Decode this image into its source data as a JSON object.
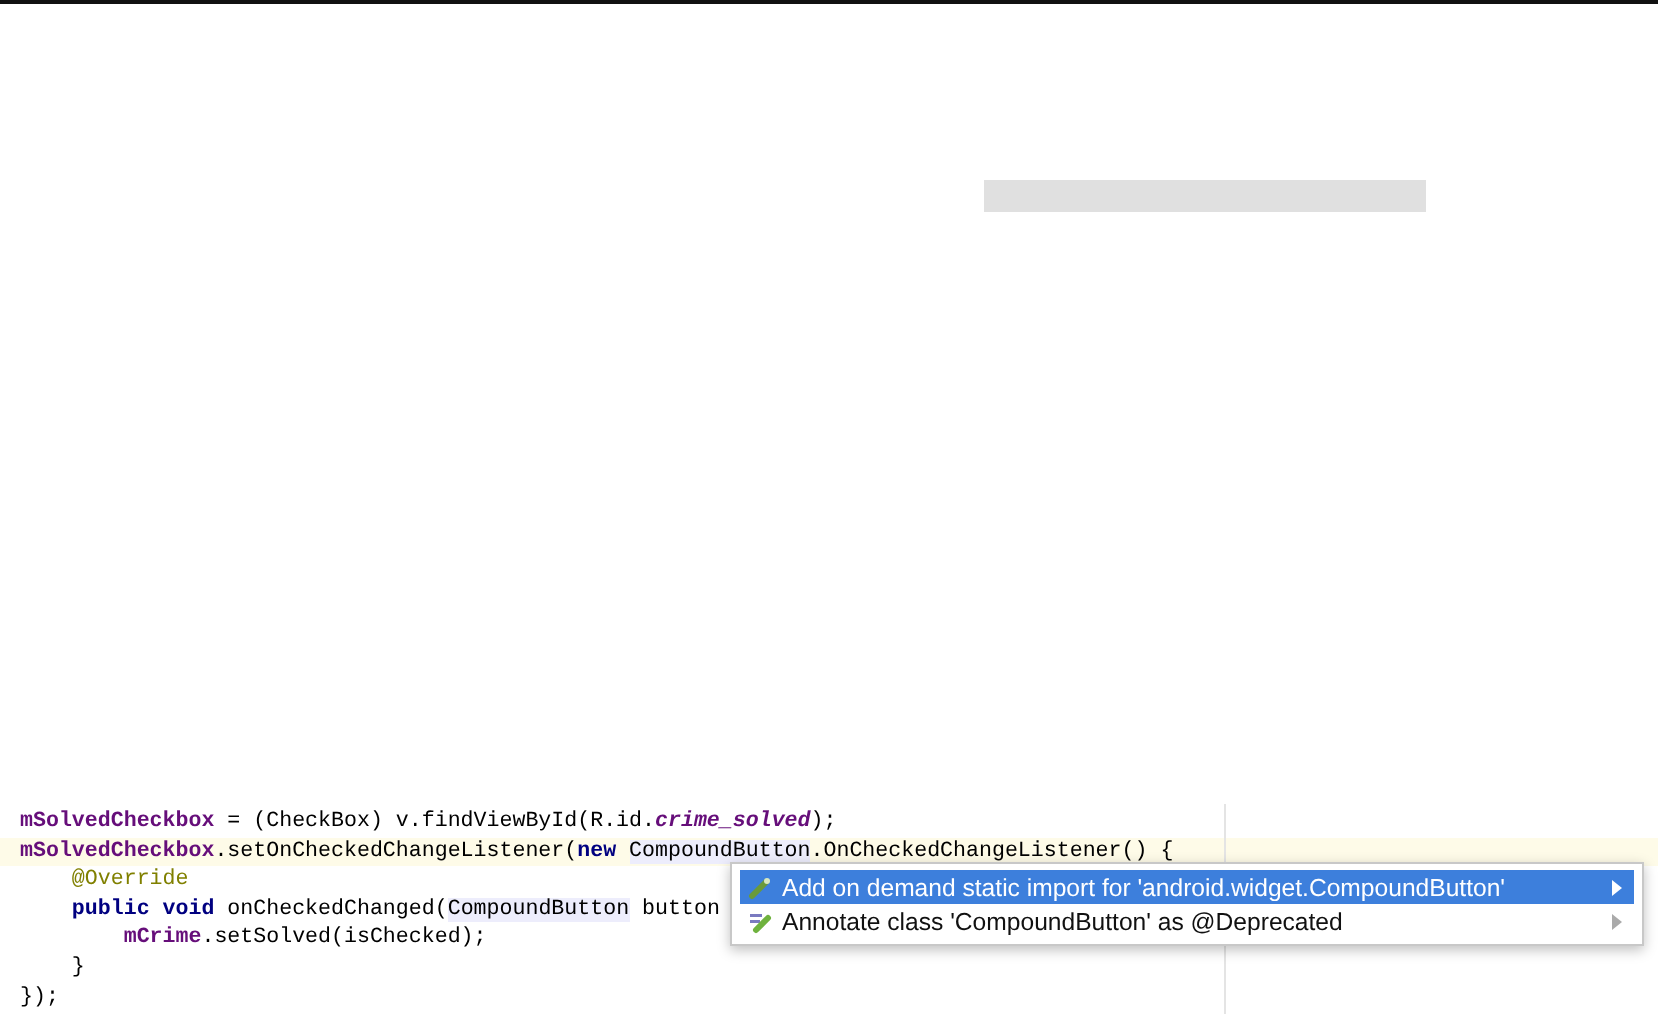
{
  "editor": {
    "lines": [
      {
        "current": false,
        "tokens": [
          {
            "kind": "field",
            "text": "mSolvedCheckbox"
          },
          {
            "kind": "plain",
            "text": " = (CheckBox) v.findViewById(R.id."
          },
          {
            "kind": "static",
            "text": "crime_solved"
          },
          {
            "kind": "plain",
            "text": ");"
          }
        ]
      },
      {
        "current": true,
        "tokens": [
          {
            "kind": "field",
            "text": "mSolvedCheckbox"
          },
          {
            "kind": "plain",
            "text": ".setOnCheckedChangeListener("
          },
          {
            "kind": "keyword",
            "text": "new "
          },
          {
            "kind": "ref",
            "text": "CompoundButton"
          },
          {
            "kind": "plain",
            "text": ".OnCheckedChangeListener() {"
          }
        ]
      },
      {
        "current": false,
        "tokens": [
          {
            "kind": "annotation",
            "text": "    @Override"
          }
        ]
      },
      {
        "current": false,
        "tokens": [
          {
            "kind": "keyword",
            "text": "    public void"
          },
          {
            "kind": "plain",
            "text": " onCheckedChanged("
          },
          {
            "kind": "ref",
            "text": "CompoundButton"
          },
          {
            "kind": "plain",
            "text": " button"
          }
        ]
      },
      {
        "current": false,
        "tokens": [
          {
            "kind": "field",
            "text": "        mCrime"
          },
          {
            "kind": "plain",
            "text": ".setSolved(isChecked);"
          }
        ]
      },
      {
        "current": false,
        "tokens": [
          {
            "kind": "plain",
            "text": "    }"
          }
        ]
      },
      {
        "current": false,
        "tokens": [
          {
            "kind": "plain",
            "text": "});"
          }
        ]
      }
    ]
  },
  "intention_menu": {
    "items": [
      {
        "label": "Add on demand static import for 'android.widget.CompoundButton'",
        "selected": true
      },
      {
        "label": "Annotate class 'CompoundButton' as @Deprecated",
        "selected": false
      }
    ]
  }
}
